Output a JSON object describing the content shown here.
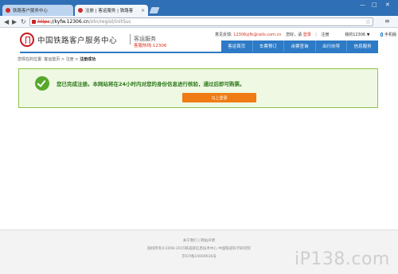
{
  "browser": {
    "tabs": [
      {
        "label": "铁路客户服务中心",
        "close": ""
      },
      {
        "label": "注册 | 客运服务 | 铁路客",
        "close": "×"
      }
    ],
    "window_controls": [
      "—",
      "□",
      "✕"
    ],
    "nav": {
      "back": "◀",
      "forward": "▶",
      "reload": "↻"
    },
    "url": {
      "scheme": "https",
      "host": "://kyfw.12306.cn",
      "path": "/otn/regist/initSuc"
    },
    "bookmark_icon": "star-icon",
    "menu_icon": "wrench-icon"
  },
  "header": {
    "brand": "中国铁路客户服务中心",
    "service": "客运服务",
    "hotline": "客服热线:12306",
    "toplinks": {
      "feedback_label": "意见反馈:",
      "feedback_email": "12306yjfk@rails.com.cn",
      "greeting": "您好，请",
      "login": "登录",
      "register": "注册",
      "my12306": "我的12306",
      "my12306_caret": "▼",
      "mobile": "手机版"
    },
    "nav": [
      "客运首页",
      "车票预订",
      "余票查询",
      "出行向导",
      "信息服务"
    ]
  },
  "breadcrumb": {
    "prefix": "您现在的位置:",
    "home": "客运首页",
    "sep1": ">",
    "register": "注册",
    "sep2": ">",
    "current": "注册成功"
  },
  "notice": {
    "message": "您已完成注册。本网站将在24小时内对您的身份信息进行核验，通过后即可购票。",
    "button": "马上登录"
  },
  "footer": {
    "links": "关于我们 | 网站声明",
    "copyright": "版权所有©2008-2015铁道部信息技术中心   中国铁道科学研究院",
    "icp": "京ICP备10009636号"
  },
  "watermark": "iP138.com",
  "colors": {
    "tab_strip": "#2f6fb5",
    "nav": "#2d7ac6",
    "accent_red": "#d9301c",
    "success_green": "#57a82a",
    "button_orange": "#f07b14"
  }
}
